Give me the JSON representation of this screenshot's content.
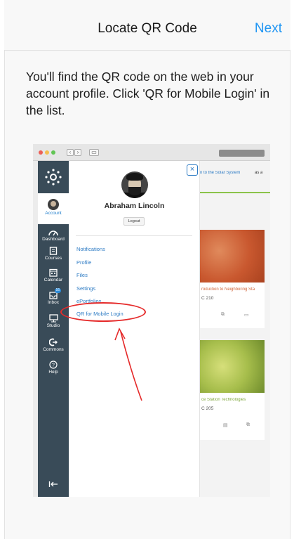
{
  "nav": {
    "title": "Locate QR Code",
    "next_label": "Next"
  },
  "instructions": "You'll find the QR code on the web in your account profile. Click 'QR for Mobile Login' in the list.",
  "screenshot": {
    "sidebar": {
      "account_label": "Account",
      "items": [
        {
          "label": "Dashboard",
          "icon": "dashboard-icon"
        },
        {
          "label": "Courses",
          "icon": "book-icon"
        },
        {
          "label": "Calendar",
          "icon": "calendar-icon"
        },
        {
          "label": "Inbox",
          "icon": "inbox-icon",
          "badge": "16"
        },
        {
          "label": "Studio",
          "icon": "studio-icon"
        },
        {
          "label": "Commons",
          "icon": "commons-icon"
        },
        {
          "label": "Help",
          "icon": "help-icon"
        }
      ]
    },
    "tray": {
      "close_glyph": "×",
      "user_name": "Abraham Lincoln",
      "logout_label": "Logout",
      "links": [
        "Notifications",
        "Profile",
        "Files",
        "Settings",
        "ePortfolios",
        "QR for Mobile Login"
      ]
    },
    "content": {
      "announcement_fragment": "n to the Solar System",
      "announcement_suffix": "as a",
      "cards": [
        {
          "title": "roduction to Neighboring Sta",
          "code": "C 210",
          "color": "#d06a3e",
          "title_color": "#d0643a"
        },
        {
          "title": "ce Station Technologies",
          "code": "C 205",
          "color": "#9bb84a",
          "title_color": "#7ea63a"
        }
      ]
    },
    "colors": {
      "sidebar": "#394b58",
      "link": "#2d7bc4",
      "highlight": "#e52a2a"
    }
  }
}
